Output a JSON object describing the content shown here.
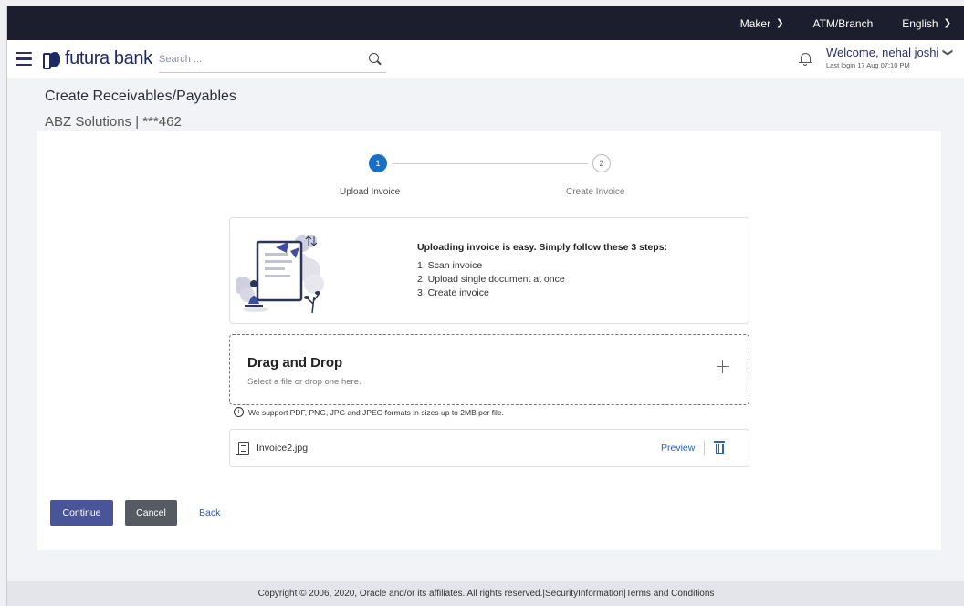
{
  "topbar": {
    "role": "Maker",
    "location": "ATM/Branch",
    "language": "English"
  },
  "header": {
    "brand": "futura bank",
    "search_placeholder": "Search ...",
    "welcome": "Welcome, nehal joshi",
    "last_login": "Last login 17 Aug 07:10 PM"
  },
  "page": {
    "title": "Create Receivables/Payables",
    "subtitle": "ABZ Solutions | ***462"
  },
  "stepper": {
    "steps": [
      {
        "number": "1",
        "label": "Upload Invoice",
        "active": true
      },
      {
        "number": "2",
        "label": "Create Invoice",
        "active": false
      }
    ]
  },
  "info": {
    "heading": "Uploading invoice is easy. Simply follow these 3 steps:",
    "steps": [
      "1. Scan invoice",
      "2. Upload single document at once",
      "3. Create invoice"
    ]
  },
  "dropzone": {
    "title": "Drag and Drop",
    "subtitle": "Select a file or drop one here."
  },
  "support_note": "We support PDF, PNG, JPG and JPEG formats in sizes up to 2MB per file.",
  "file": {
    "name": "Invoice2.jpg",
    "preview_label": "Preview"
  },
  "actions": {
    "continue_label": "Continue",
    "cancel_label": "Cancel",
    "back_label": "Back"
  },
  "footer": {
    "text": "Copyright © 2006, 2020, Oracle and/or its affiliates. All rights reserved.|SecurityInformation|Terms and Conditions"
  },
  "colors": {
    "topbar_bg": "#1c1e2e",
    "brand": "#1c2a5e",
    "step_active": "#1770c6",
    "primary_button": "#4a5499",
    "secondary_button": "#555a63",
    "link": "#2b63b8"
  }
}
